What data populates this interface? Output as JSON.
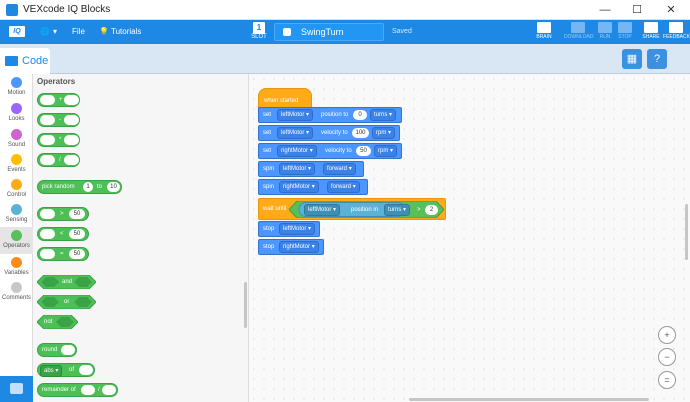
{
  "window": {
    "title": "VEXcode IQ Blocks",
    "minimize": "—",
    "maximize": "☐",
    "close": "✕"
  },
  "toolbar": {
    "logo": "IQ",
    "language": "🌐",
    "file": "File",
    "tutorials": "Tutorials",
    "slot_label": "SLOT",
    "slot_number": "1",
    "project_name": "SwingTurn",
    "saved": "Saved",
    "brain": "BRAIN",
    "download": "DOWNLOAD",
    "run": "RUN",
    "stop": "STOP",
    "share": "SHARE",
    "feedback": "FEEDBACK"
  },
  "codebar": {
    "code_tab": "Code",
    "save_icon": "device-icon",
    "help": "?"
  },
  "categories": [
    {
      "label": "Motion",
      "color": "#4c97ff"
    },
    {
      "label": "Looks",
      "color": "#9966ff"
    },
    {
      "label": "Sound",
      "color": "#cf63cf"
    },
    {
      "label": "Events",
      "color": "#ffbf00"
    },
    {
      "label": "Control",
      "color": "#ffab19"
    },
    {
      "label": "Sensing",
      "color": "#5cb1d6"
    },
    {
      "label": "Operators",
      "color": "#59c059"
    },
    {
      "label": "Variables",
      "color": "#ff8c1a"
    },
    {
      "label": "Comments",
      "color": "#c7c7c7"
    }
  ],
  "palette": {
    "title": "Operators",
    "arith": [
      "+",
      "-",
      "*",
      "/"
    ],
    "pick_random": {
      "label": "pick random",
      "from": "1",
      "to_label": "to",
      "to": "10"
    },
    "compare": [
      {
        "op": ">",
        "value": "50"
      },
      {
        "op": "<",
        "value": "50"
      },
      {
        "op": "=",
        "value": "50"
      }
    ],
    "and": "and",
    "or": "or",
    "not": "not",
    "round": "round",
    "abs": "abs",
    "of": "of",
    "remainder": "remainder of",
    "remainder_op": "/"
  },
  "script": {
    "hat": "when started",
    "blocks": [
      {
        "verb": "set",
        "device": "leftMotor",
        "mid": "position to",
        "value": "0",
        "unit": "turns"
      },
      {
        "verb": "set",
        "device": "leftMotor",
        "mid": "velocity to",
        "value": "100",
        "unit": "rpm"
      },
      {
        "verb": "set",
        "device": "rightMotor",
        "mid": "velocity to",
        "value": "50",
        "unit": "rpm"
      },
      {
        "verb": "spin",
        "device": "leftMotor",
        "direction": "forward"
      },
      {
        "verb": "spin",
        "device": "rightMotor",
        "direction": "forward"
      }
    ],
    "wait": {
      "label": "wait until",
      "device": "leftMotor",
      "mid": "position in",
      "unit": "turns",
      "op": ">",
      "value": "2"
    },
    "stops": [
      {
        "verb": "stop",
        "device": "leftMotor"
      },
      {
        "verb": "stop",
        "device": "rightMotor"
      }
    ]
  },
  "zoom": {
    "in": "+",
    "out": "−",
    "reset": "="
  }
}
